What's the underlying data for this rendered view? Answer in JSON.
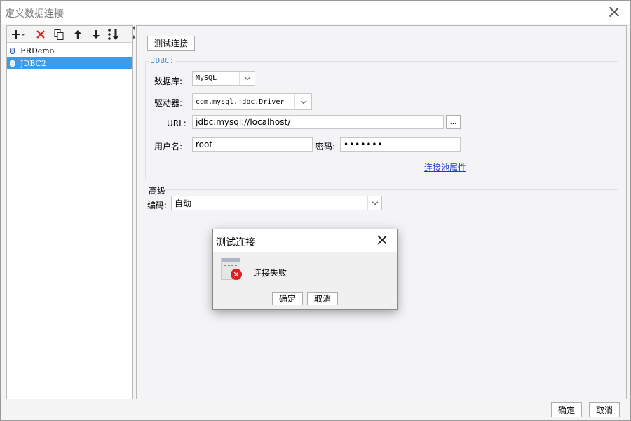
{
  "window": {
    "title": "定义数据连接"
  },
  "connections": [
    {
      "name": "FRDemo",
      "selected": false
    },
    {
      "name": "JDBC2",
      "selected": true
    }
  ],
  "toolbar": {
    "add": "+",
    "delete": "✕",
    "copy": "⧉",
    "up": "↑",
    "down": "↓",
    "sort": "⇊"
  },
  "test_connection_label": "测试连接",
  "jdbc": {
    "legend": "JDBC:",
    "database_label": "数据库:",
    "database_value": "MySQL",
    "driver_label": "驱动器:",
    "driver_value": "com.mysql.jdbc.Driver",
    "url_label": "URL:",
    "url_value": "jdbc:mysql://localhost/",
    "url_browse": "...",
    "username_label": "用户名:",
    "username_value": "root",
    "password_label": "密码:",
    "password_value": "•••••••",
    "pool_link": "连接池属性"
  },
  "advanced": {
    "header": "高级",
    "encoding_label": "编码:",
    "encoding_value": "自动"
  },
  "footer": {
    "ok": "确定",
    "cancel": "取消"
  },
  "modal": {
    "title": "测试连接",
    "message": "连接失败",
    "ok": "确定",
    "cancel": "取消"
  },
  "colors": {
    "selection": "#3d9ce9",
    "legend": "#3a8ad6",
    "link": "#1a3ad6",
    "error": "#e02020"
  }
}
